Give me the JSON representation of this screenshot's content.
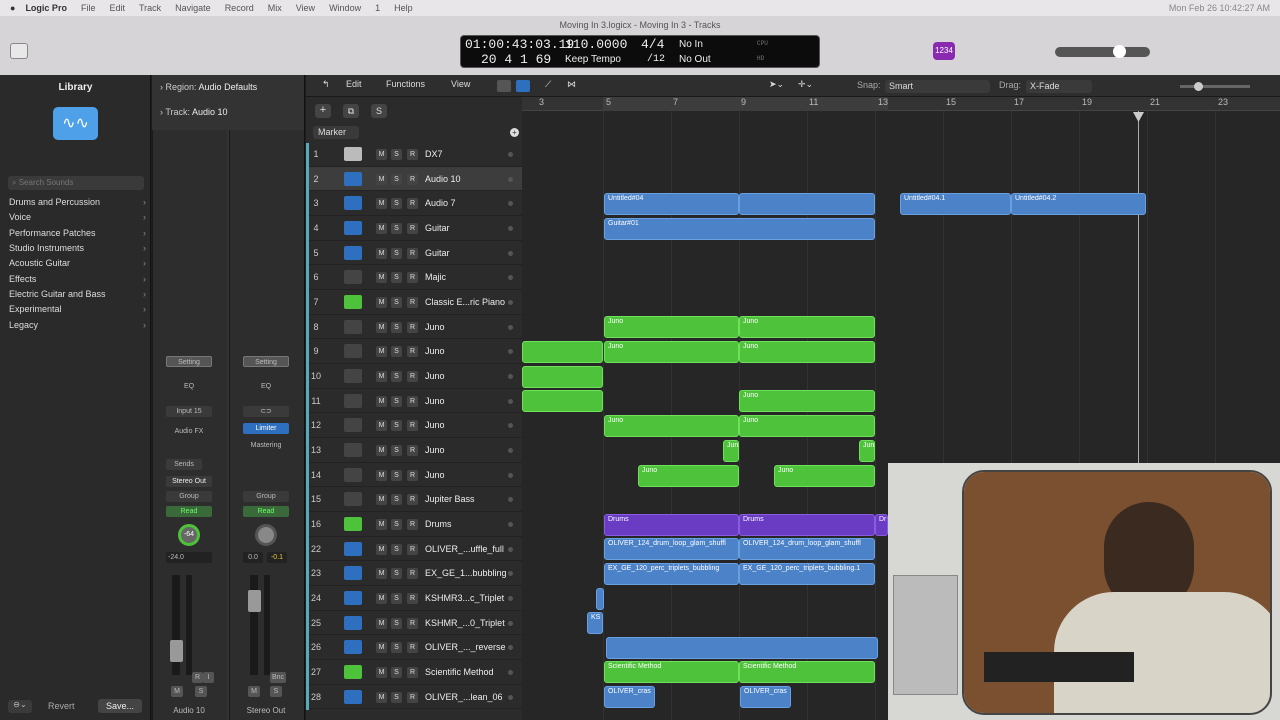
{
  "menubar": {
    "app": "Logic Pro",
    "items": [
      "File",
      "Edit",
      "Track",
      "Navigate",
      "Record",
      "Mix",
      "View",
      "Window",
      "1",
      "Help"
    ],
    "clock": "Mon Feb 26  10:42:27 AM"
  },
  "window_title": "Moving In 3.logicx - Moving In 3 - Tracks",
  "lcd": {
    "time": "01:00:43:03.19",
    "bars": "20  4  1   69",
    "tempo": "110.0000",
    "tempo_label": "Keep Tempo",
    "sig": "4/4",
    "sig_div": "/12",
    "in": "No In",
    "out": "No Out",
    "cpu": "CPU",
    "hd": "HD"
  },
  "toolbar_badge": "1234",
  "library": {
    "title": "Library",
    "search_placeholder": "Search Sounds",
    "categories": [
      "Drums and Percussion",
      "Voice",
      "Performance Patches",
      "Studio Instruments",
      "Acoustic Guitar",
      "Effects",
      "Electric Guitar and Bass",
      "Experimental",
      "Legacy"
    ]
  },
  "inspector": {
    "region": "Region:",
    "region_value": "Audio Defaults",
    "track": "Track:",
    "track_value": "Audio 10"
  },
  "strip1": {
    "setting": "Setting",
    "eq": "EQ",
    "input": "Input 15",
    "fx": "Audio FX",
    "sends": "Sends",
    "out": "Stereo Out",
    "group": "Group",
    "read": "Read",
    "pan": "-64",
    "vol": "-24.0",
    "name": "Audio 10",
    "m": "M",
    "s": "S",
    "r": "R",
    "i": "I"
  },
  "strip2": {
    "setting": "Setting",
    "eq": "EQ",
    "limiter": "Limiter",
    "mastering": "Mastering",
    "group": "Group",
    "read": "Read",
    "vol": "0.0",
    "peak": "-0.1",
    "bnc": "Bnc",
    "name": "Stereo Out",
    "m": "M",
    "s": "S"
  },
  "footer": {
    "revert": "Revert",
    "save": "Save..."
  },
  "edit_toolbar": {
    "edit": "Edit",
    "functions": "Functions",
    "view": "View",
    "snap_label": "Snap:",
    "snap": "Smart",
    "drag_label": "Drag:",
    "drag": "X-Fade",
    "marker": "Marker",
    "s_btn": "S"
  },
  "ruler": [
    "3",
    "5",
    "7",
    "9",
    "11",
    "13",
    "15",
    "17",
    "19",
    "21",
    "23"
  ],
  "track_controls": {
    "m": "M",
    "s": "S",
    "r": "R"
  },
  "tracks": [
    {
      "num": "1",
      "name": "DX7"
    },
    {
      "num": "2",
      "name": "Audio 10"
    },
    {
      "num": "3",
      "name": "Audio 7"
    },
    {
      "num": "4",
      "name": "Guitar"
    },
    {
      "num": "5",
      "name": "Guitar"
    },
    {
      "num": "6",
      "name": "Majic"
    },
    {
      "num": "7",
      "name": "Classic E...ric Piano"
    },
    {
      "num": "8",
      "name": "Juno"
    },
    {
      "num": "9",
      "name": "Juno"
    },
    {
      "num": "10",
      "name": "Juno"
    },
    {
      "num": "11",
      "name": "Juno"
    },
    {
      "num": "12",
      "name": "Juno"
    },
    {
      "num": "13",
      "name": "Juno"
    },
    {
      "num": "14",
      "name": "Juno"
    },
    {
      "num": "15",
      "name": "Jupiter Bass"
    },
    {
      "num": "16",
      "name": "Drums"
    },
    {
      "num": "22",
      "name": "OLIVER_...uffle_full"
    },
    {
      "num": "23",
      "name": "EX_GE_1...bubbling"
    },
    {
      "num": "24",
      "name": "KSHMR3...c_Triplet"
    },
    {
      "num": "25",
      "name": "KSHMR_...0_Triplet"
    },
    {
      "num": "26",
      "name": "OLIVER_..._reverse"
    },
    {
      "num": "27",
      "name": "Scientific Method"
    },
    {
      "num": "28",
      "name": "OLIVER_...lean_06"
    }
  ],
  "regions": {
    "untitled04": "Untitled#04",
    "untitled041": "Untitled#04.1",
    "untitled042": "Untitled#04.2",
    "guitar01": "Guitar#01",
    "juno": "Juno",
    "jun": "Jun",
    "drums": "Drums",
    "dr": "Dr",
    "oliver_shuffle": "OLIVER_124_drum_loop_glam_shuffl",
    "ex_ge": "EX_GE_120_perc_triplets_bubbling",
    "ex_ge1": "EX_GE_120_perc_triplets_bubbling.1",
    "ks": "KS",
    "scientific": "Scientific Method",
    "oliver_cras": "OLIVER_cras"
  },
  "colors": {
    "audio": "#4b82c8",
    "midi": "#4ec23a",
    "drummer": "#6a3cc4"
  }
}
